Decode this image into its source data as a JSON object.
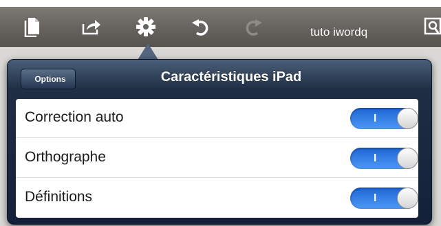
{
  "toolbar": {
    "icons": [
      "documents-icon",
      "share-icon",
      "gear-icon",
      "undo-icon",
      "redo-icon"
    ],
    "document_title": "tuto iwordq"
  },
  "popover": {
    "back_label": "Options",
    "title": "Caractéristiques iPad",
    "settings": [
      {
        "label": "Correction auto",
        "on": true,
        "switch_text": "I"
      },
      {
        "label": "Orthographe",
        "on": true,
        "switch_text": "I"
      },
      {
        "label": "Définitions",
        "on": true,
        "switch_text": "I"
      }
    ]
  },
  "colors": {
    "toolbar": "#66635f",
    "popover_header": "#1f2e44",
    "switch_on": "#2f7ee8"
  }
}
